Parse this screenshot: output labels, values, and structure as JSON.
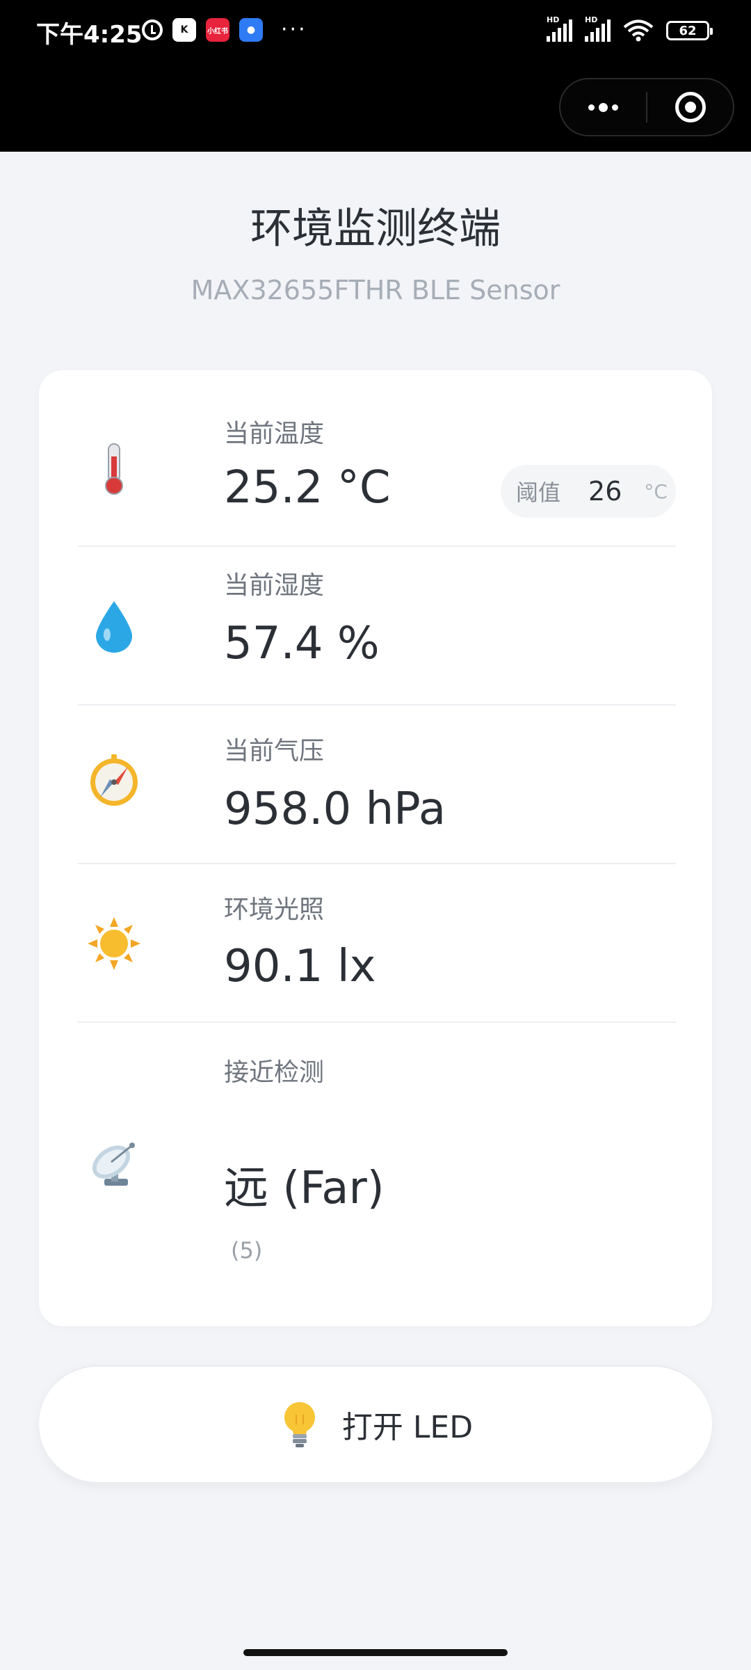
{
  "status_bar": {
    "time": "下午4:25",
    "app_icons": [
      "K",
      "小红书",
      "●"
    ],
    "more": "···",
    "hd1": "HD",
    "hd2": "HD",
    "battery": "62"
  },
  "header": {
    "title": "环境监测终端",
    "subtitle": "MAX32655FTHR BLE Sensor"
  },
  "readings": {
    "temperature": {
      "label": "当前温度",
      "value": "25.2 °C",
      "icon": "thermometer-icon",
      "threshold_label": "阈值",
      "threshold_value": "26",
      "threshold_unit": "°C"
    },
    "humidity": {
      "label": "当前湿度",
      "value": "57.4 %",
      "icon": "droplet-icon"
    },
    "pressure": {
      "label": "当前气压",
      "value": "958.0 hPa",
      "icon": "compass-icon"
    },
    "light": {
      "label": "环境光照",
      "value": "90.1 lx",
      "icon": "sun-icon"
    },
    "proximity": {
      "label": "接近检测",
      "value": "远 (Far)",
      "raw": "(5)",
      "icon": "satellite-dish-icon"
    }
  },
  "led_button": {
    "label": "打开 LED",
    "icon": "light-bulb-icon"
  },
  "colors": {
    "background": "#f2f4f7",
    "card": "#ffffff",
    "text_primary": "#2b2f36",
    "text_secondary": "#6f757e",
    "subtitle": "#a6adb6"
  }
}
